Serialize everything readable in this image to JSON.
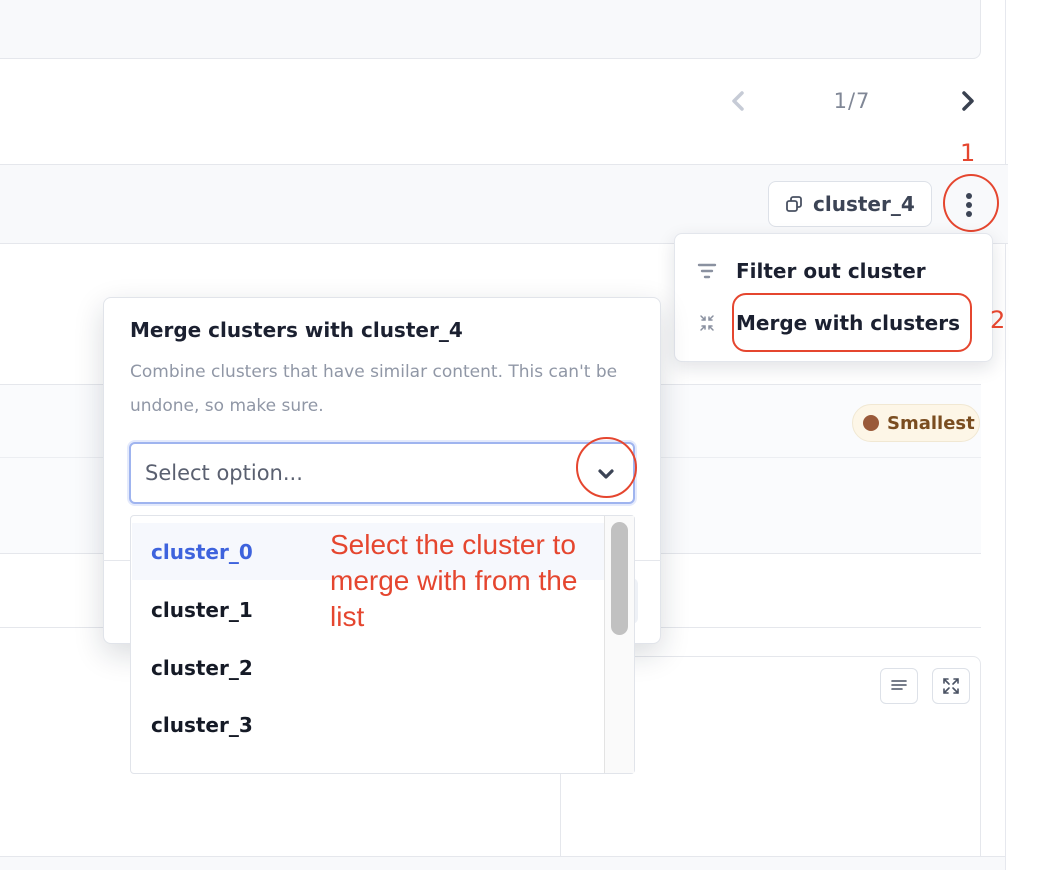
{
  "pagination": {
    "text": "1/7"
  },
  "cluster_row": {
    "chip_label": "cluster_4"
  },
  "badge": {
    "label": "Smallest"
  },
  "context_menu": {
    "items": [
      {
        "label": "Filter out cluster",
        "icon": "filter-icon"
      },
      {
        "label": "Merge with clusters",
        "icon": "merge-icon"
      }
    ]
  },
  "modal": {
    "title": "Merge clusters with cluster_4",
    "description": "Combine clusters that have similar content. This can't be undone, so make sure.",
    "select_placeholder": "Select option...",
    "options": [
      "cluster_0",
      "cluster_1",
      "cluster_2",
      "cluster_3"
    ],
    "highlighted_option": "cluster_0"
  },
  "annotations": {
    "step1": "1",
    "step2": "2",
    "note": "Select the cluster to merge with from the list"
  },
  "colors": {
    "annotation": "#e5462f",
    "accent_blue": "#3e63dd",
    "badge_bg": "#fdf6e7"
  }
}
